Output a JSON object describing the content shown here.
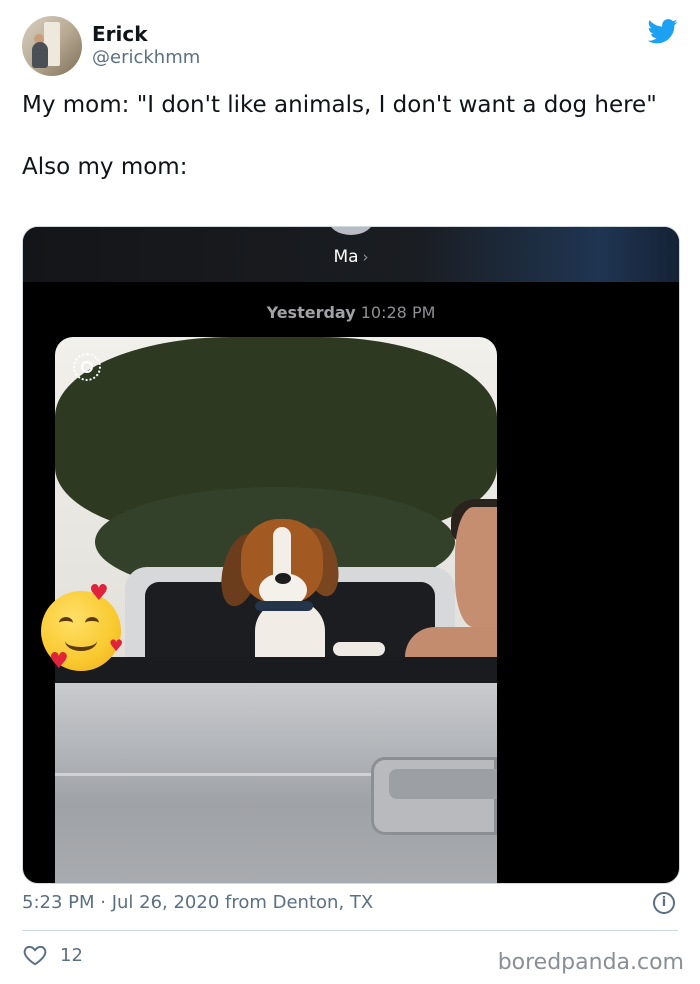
{
  "user": {
    "name": "Erick",
    "handle": "@erickhmm"
  },
  "tweet": {
    "text": "My mom: \"I don't like animals, I don't want a dog here\"\n\nAlso my mom:"
  },
  "screenshot": {
    "contact_name": "Ma",
    "timestamp_day": "Yesterday",
    "timestamp_time": "10:28 PM"
  },
  "footer": {
    "meta": "5:23 PM · Jul 26, 2020 from Denton, TX",
    "like_count": "12"
  },
  "watermark": "boredpanda.com",
  "icons": {
    "brand": "twitter-bird-icon",
    "info": "info-icon",
    "like": "heart-outline-icon",
    "live_photo": "live-photo-icon",
    "emoji": "smiling-face-with-hearts-emoji"
  },
  "colors": {
    "twitter_blue": "#1da1f2",
    "secondary_text": "#5b7083",
    "primary_text": "#0f1419"
  }
}
